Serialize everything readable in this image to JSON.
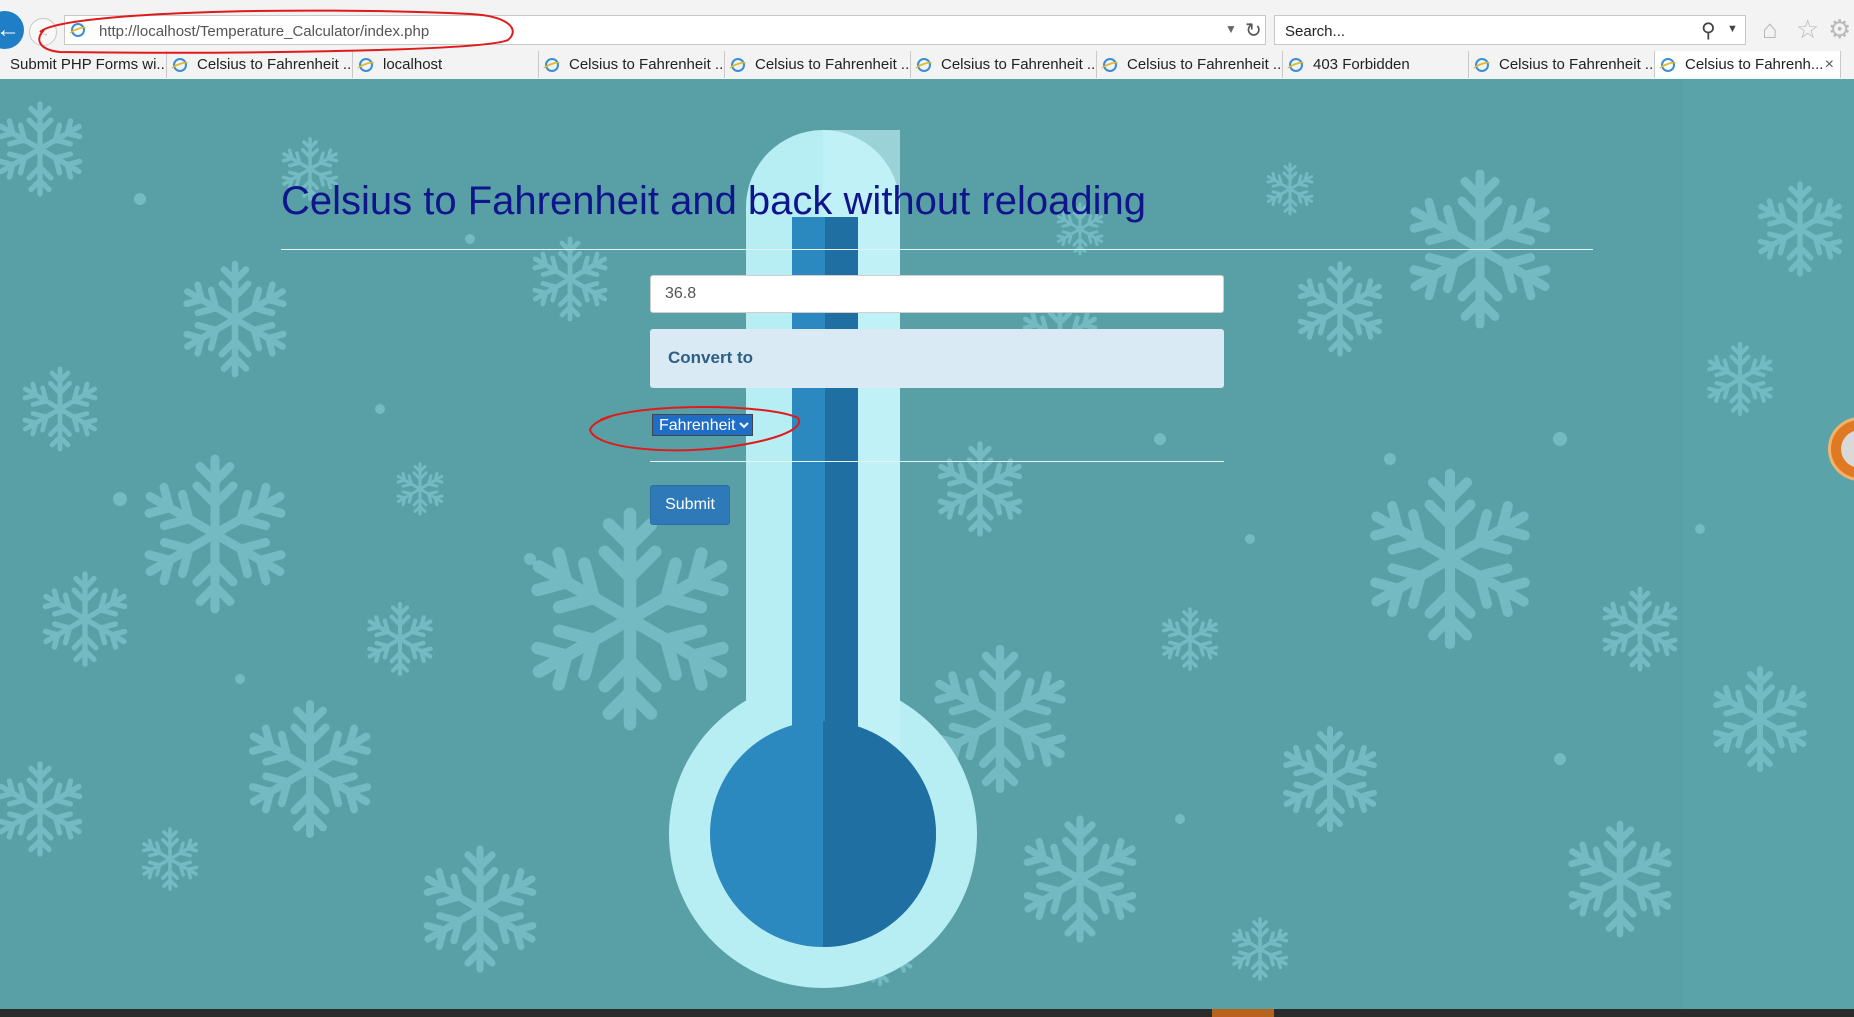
{
  "browser": {
    "address_url": "http://localhost/Temperature_Calculator/index.php",
    "search_placeholder": "Search...",
    "tabs": [
      {
        "label": "Submit PHP Forms wi..."
      },
      {
        "label": "Celsius to Fahrenheit ..."
      },
      {
        "label": "localhost"
      },
      {
        "label": "Celsius to Fahrenheit ..."
      },
      {
        "label": "Celsius to Fahrenheit ..."
      },
      {
        "label": "Celsius to Fahrenheit ..."
      },
      {
        "label": "Celsius to Fahrenheit ..."
      },
      {
        "label": "403 Forbidden"
      },
      {
        "label": "Celsius to Fahrenheit ..."
      },
      {
        "label": "Celsius to Fahrenh..."
      }
    ],
    "active_tab_index": 9,
    "close_glyph": "×"
  },
  "page": {
    "title": "Celsius to Fahrenheit and back without reloading",
    "temperature_value": "36.8",
    "convert_label": "Convert to",
    "select_selected": "Fahrenheit",
    "submit_label": "Submit"
  },
  "colors": {
    "page_background": "#58a0a6",
    "title_color": "#10158c",
    "convert_panel": "#d9eaf4",
    "submit_button": "#2e7ab8",
    "annotation_red": "#e01b1b"
  },
  "icons": {
    "back": "back-arrow-icon",
    "forward": "forward-arrow-icon",
    "site": "ie-page-icon",
    "refresh": "refresh-icon",
    "search": "search-icon",
    "home": "home-icon",
    "favorites": "star-icon",
    "tools": "gear-icon"
  }
}
